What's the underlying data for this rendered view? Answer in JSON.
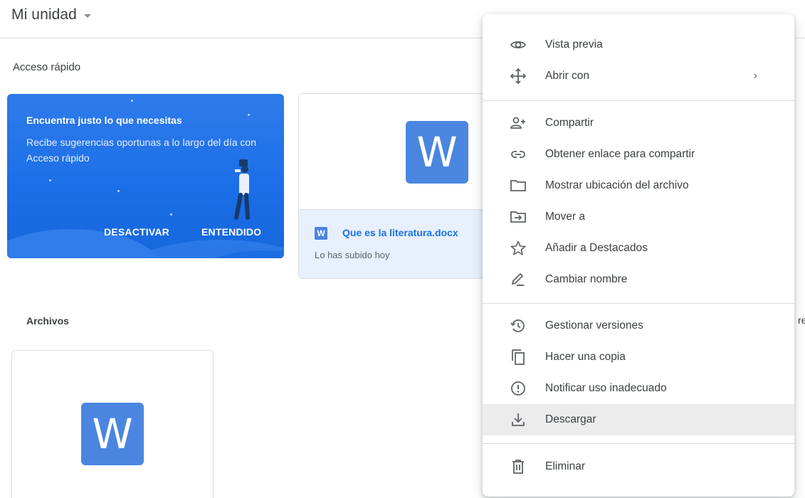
{
  "header": {
    "title": "Mi unidad"
  },
  "quick_access": {
    "label": "Acceso rápido",
    "promo": {
      "title": "Encuentra justo lo que necesitas",
      "text": "Recibe sugerencias oportunas a lo largo del día con Acceso rápido",
      "dismiss_label": "DESACTIVAR",
      "accept_label": "ENTENDIDO"
    },
    "doc": {
      "file_name": "Que es la literatura.docx",
      "subtitle": "Lo has subido hoy",
      "icon_letter": "W"
    }
  },
  "files": {
    "label": "Archivos",
    "icon_letter": "W",
    "partial_text": "re"
  },
  "context_menu": {
    "items": [
      {
        "icon": "eye-icon",
        "label": "Vista previa"
      },
      {
        "icon": "move-arrows-icon",
        "label": "Abrir con",
        "has_submenu": true,
        "arrow": "›"
      },
      {
        "icon": "add-person-icon",
        "label": "Compartir"
      },
      {
        "icon": "link-icon",
        "label": "Obtener enlace para compartir"
      },
      {
        "icon": "folder-icon",
        "label": "Mostrar ubicación del archivo"
      },
      {
        "icon": "move-to-folder-icon",
        "label": "Mover a"
      },
      {
        "icon": "star-icon",
        "label": "Añadir a Destacados"
      },
      {
        "icon": "pencil-icon",
        "label": "Cambiar nombre"
      },
      {
        "icon": "history-icon",
        "label": "Gestionar versiones"
      },
      {
        "icon": "copy-icon",
        "label": "Hacer una copia"
      },
      {
        "icon": "report-icon",
        "label": "Notificar uso inadecuado"
      },
      {
        "icon": "download-icon",
        "label": "Descargar",
        "highlighted": true
      },
      {
        "icon": "trash-icon",
        "label": "Eliminar"
      }
    ]
  },
  "colors": {
    "accent": "#1a73e8",
    "promo_blue": "#1c6fe8",
    "word_blue": "#4a86e0",
    "highlight": "#ececec"
  }
}
